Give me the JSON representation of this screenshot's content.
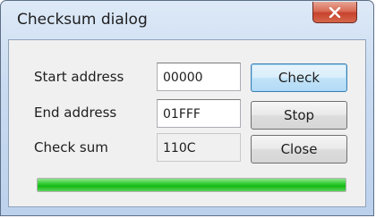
{
  "window": {
    "title": "Checksum dialog"
  },
  "fields": {
    "start_address": {
      "label": "Start address",
      "value": "00000"
    },
    "end_address": {
      "label": "End address",
      "value": "01FFF"
    },
    "check_sum": {
      "label": "Check sum",
      "value": "110C"
    }
  },
  "buttons": {
    "check": "Check",
    "stop": "Stop",
    "close": "Close"
  },
  "progress": {
    "fraction": 1.0,
    "color": "#22c322"
  },
  "colors": {
    "close_button": "#c7432d",
    "default_button_border": "#3c7fb1"
  }
}
